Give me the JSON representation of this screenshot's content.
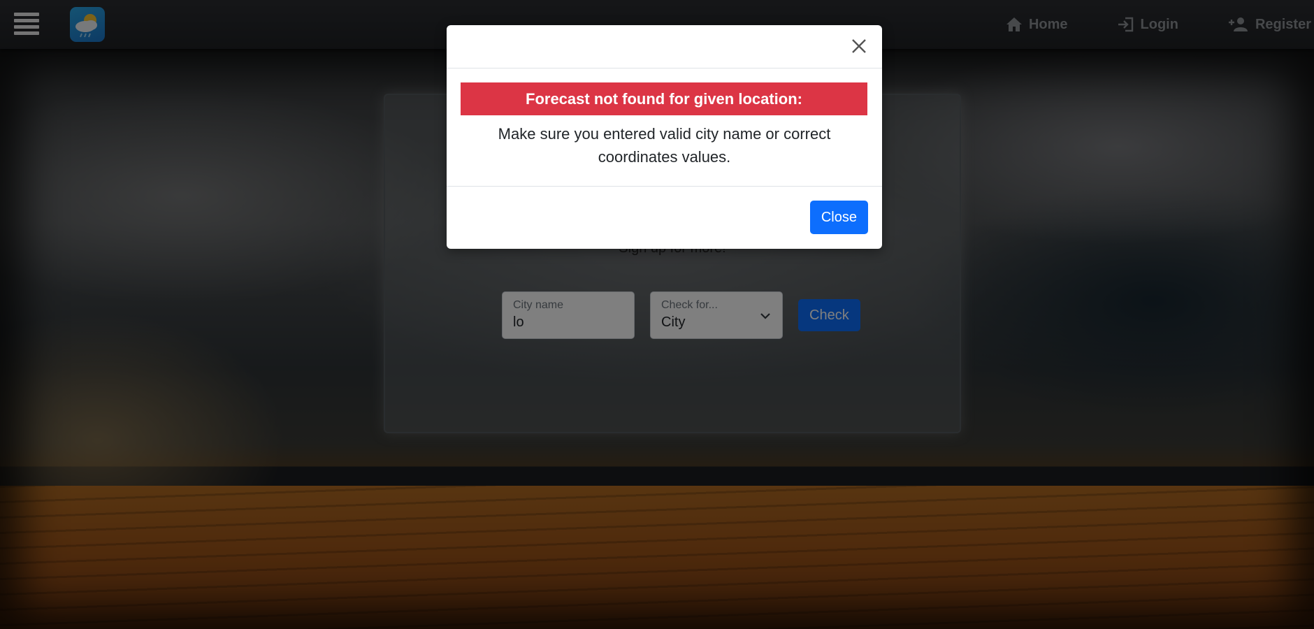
{
  "navbar": {
    "menu_icon": "hamburger-menu-icon",
    "logo_icon": "weather-cloud-sun-rain-icon",
    "links": [
      {
        "label": "Home",
        "icon": "home-icon"
      },
      {
        "label": "Login",
        "icon": "login-icon"
      },
      {
        "label": "Register",
        "icon": "person-add-icon"
      }
    ]
  },
  "card": {
    "signup_text": "Sign up for more!",
    "city_field": {
      "label": "City name",
      "value": "lo"
    },
    "check_select": {
      "label": "Check for...",
      "value": "City"
    },
    "check_button": "Check"
  },
  "modal": {
    "close_icon": "close-x-icon",
    "alert_text": "Forecast not found for given location:",
    "message": "Make sure you entered valid city name or correct coordinates values.",
    "close_button": "Close"
  },
  "colors": {
    "alert_danger": "#dc3545",
    "primary": "#0d6efd",
    "navbar": "#1f2124"
  }
}
